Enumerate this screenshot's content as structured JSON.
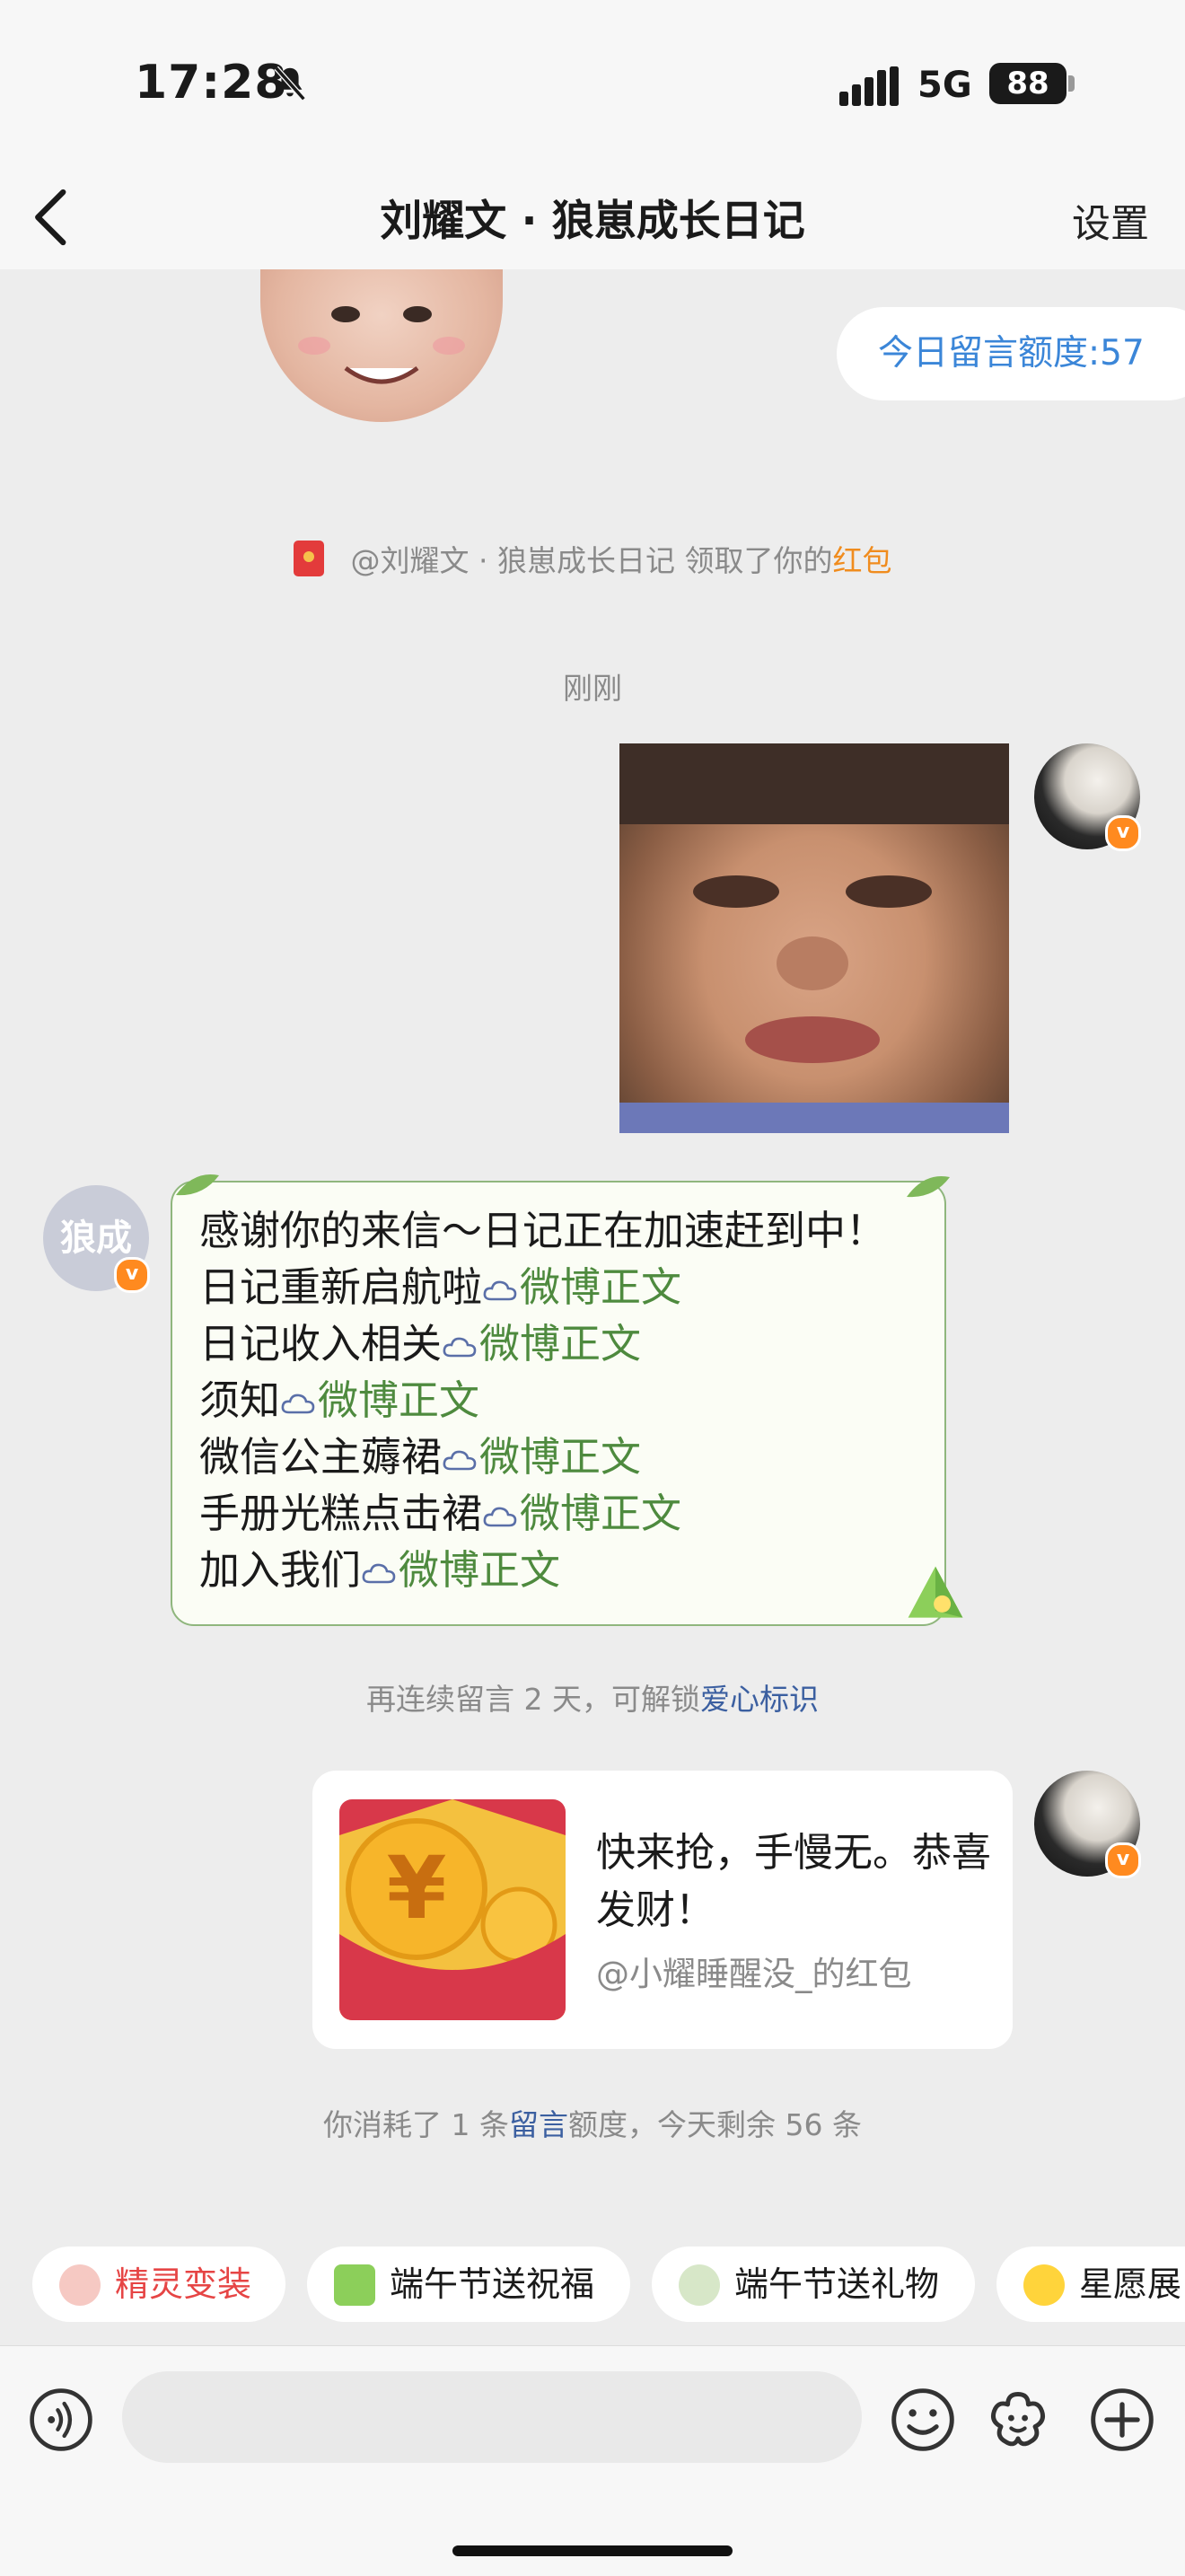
{
  "status": {
    "time": "17:28",
    "network": "5G",
    "battery": "88"
  },
  "nav": {
    "title": "刘耀文 · 狼崽成长日记",
    "settings_label": "设置"
  },
  "chat": {
    "quota_pill": "今日留言额度:57",
    "claim_notice": {
      "prefix": "@刘耀文 · 狼崽成长日记 领取了你的",
      "highlight": "红包"
    },
    "timestamp": "刚刚",
    "bot_avatar_text": "狼成崽长",
    "bot_message": {
      "lines": [
        {
          "text": "感谢你的来信～日记正在加速赶到中！",
          "link": ""
        },
        {
          "text": "日记重新启航啦",
          "link": "微博正文"
        },
        {
          "text": "日记收入相关",
          "link": "微博正文"
        },
        {
          "text": "须知",
          "link": "微博正文"
        },
        {
          "text": "微信公主薅裙",
          "link": "微博正文"
        },
        {
          "text": "手册光糕点击裙",
          "link": "微博正文"
        },
        {
          "text": "加入我们",
          "link": "微博正文"
        }
      ]
    },
    "unlock_notice": {
      "prefix": "再连续留言 2 天，可解锁",
      "highlight": "爱心标识"
    },
    "red_packet": {
      "message": "快来抢，手慢无。恭喜发财！",
      "from": "@小耀睡醒没_的红包",
      "symbol": "¥"
    },
    "consume_notice": {
      "prefix": "你消耗了 1 条",
      "highlight": "留言",
      "suffix": "额度，今天剩余 56 条"
    }
  },
  "chips": [
    {
      "label": "精灵变装",
      "icon": "pig-icon",
      "color": "#e64545"
    },
    {
      "label": "端午节送祝福",
      "icon": "zongzi-icon",
      "color": "#222222"
    },
    {
      "label": "端午节送礼物",
      "icon": "dragon-boat-icon",
      "color": "#222222"
    },
    {
      "label": "星愿展",
      "icon": "star-icon",
      "color": "#222222"
    }
  ],
  "input": {
    "placeholder": ""
  },
  "colors": {
    "accent_blue": "#3b86d8",
    "link_green": "#4e8a3e",
    "highlight_orange": "#f08c1e",
    "badge_orange": "#ff8a1f"
  }
}
